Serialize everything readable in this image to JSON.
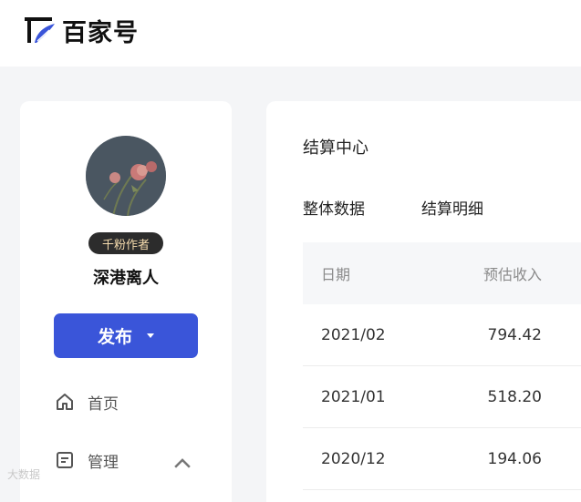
{
  "header": {
    "logo_text": "百家号"
  },
  "profile": {
    "badge": "千粉作者",
    "author_name": "深港离人",
    "publish_label": "发布"
  },
  "nav": {
    "home": "首页",
    "manage": "管理"
  },
  "settlement": {
    "title": "结算中心",
    "tabs": [
      "整体数据",
      "结算明细"
    ],
    "columns": [
      "日期",
      "预估收入"
    ],
    "rows": [
      {
        "date": "2021/02",
        "income": "794.42"
      },
      {
        "date": "2021/01",
        "income": "518.20"
      },
      {
        "date": "2020/12",
        "income": "194.06"
      }
    ]
  },
  "watermark": "大数据",
  "colors": {
    "accent": "#3a55d9",
    "badge_bg": "#2c2c2c",
    "badge_text": "#f6dcae"
  }
}
